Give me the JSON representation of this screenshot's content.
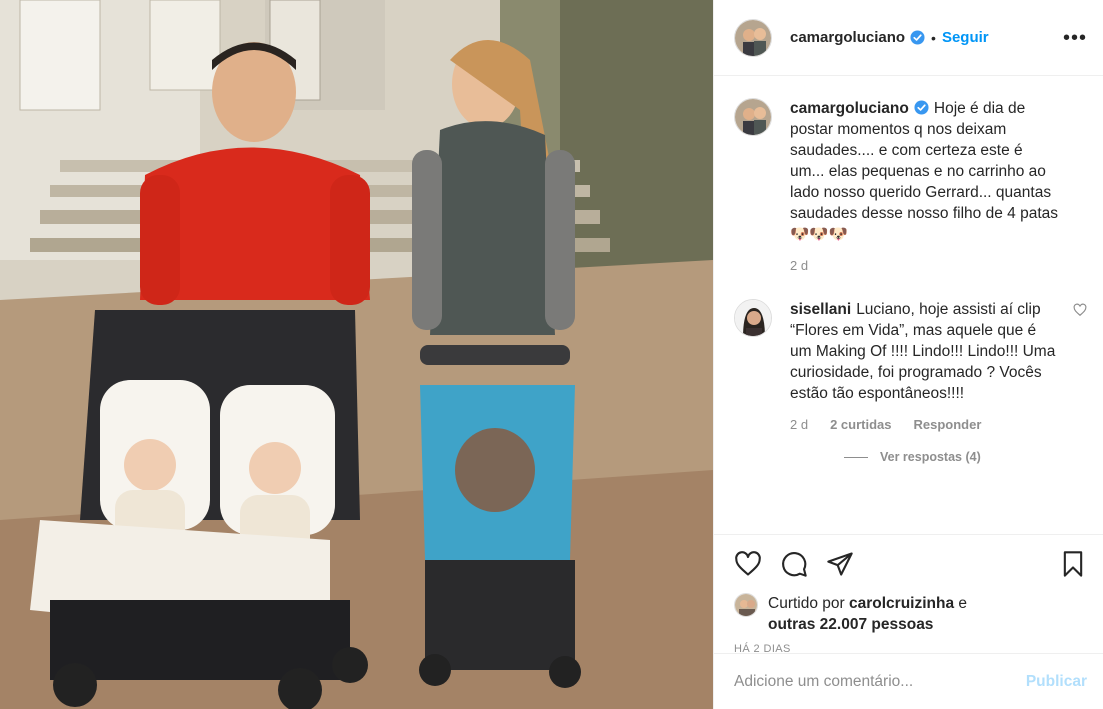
{
  "post": {
    "author": "camargoluciano",
    "follow_label": "Seguir",
    "separator": "•",
    "more_label": "•••"
  },
  "caption": {
    "user": "camargoluciano",
    "text": "Hoje é dia de postar momentos q nos deixam saudades.... e com certeza este é um... elas pequenas e no carrinho ao lado nosso querido Gerrard... quantas saudades desse nosso filho de 4 patas🐶🐶🐶",
    "time": "2 d"
  },
  "comments": [
    {
      "user": "sisellani",
      "text": "Luciano, hoje assisti aí clip “Flores em Vida”, mas aquele que é um Making Of !!!! Lindo!!! Lindo!!! Uma curiosidade, foi programado ? Vocês estão tão espontâneos!!!!",
      "time": "2 d",
      "likes": "2 curtidas",
      "reply_label": "Responder",
      "view_replies": "Ver respostas (4)"
    }
  ],
  "likes": {
    "prefix": "Curtido por",
    "first_user": "carolcruizinha",
    "connector": "e",
    "others": "outras 22.007 pessoas"
  },
  "timestamp": "HÁ 2 DIAS",
  "add_comment": {
    "placeholder": "Adicione um comentário...",
    "publish_label": "Publicar"
  },
  "colors": {
    "link": "#0095f6",
    "publish_disabled": "#b2dffc",
    "muted": "#8e8e8e"
  }
}
